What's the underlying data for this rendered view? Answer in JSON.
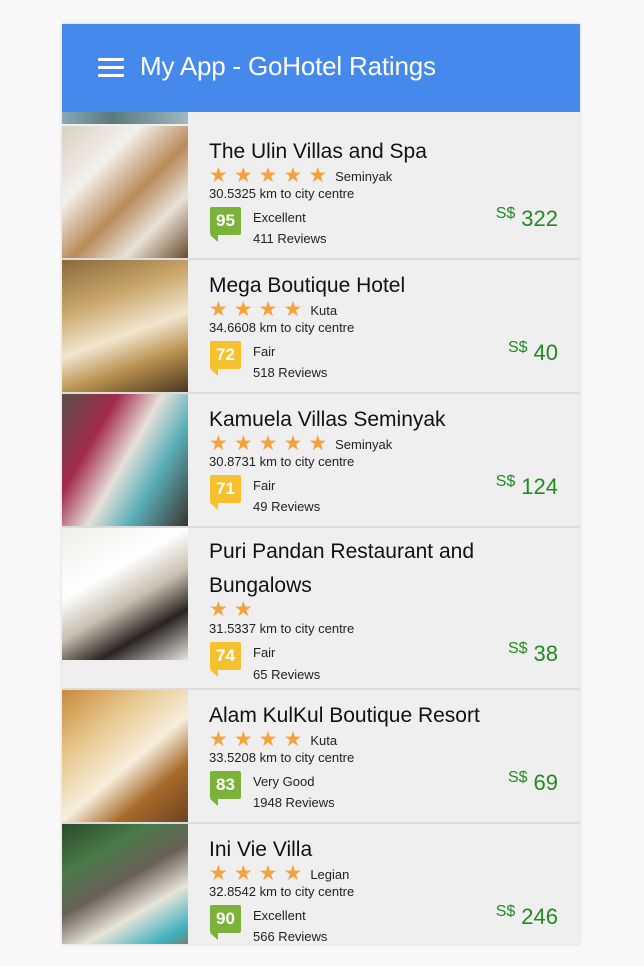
{
  "app": {
    "title": "My App - GoHotel Ratings"
  },
  "colors": {
    "header": "#4589ec",
    "star": "#f5a23a",
    "price": "#228a22",
    "score_good": "#7bb33a",
    "score_fair": "#f5c12e"
  },
  "hotels": [
    {
      "name": "The Ulin Villas and Spa",
      "stars": 5,
      "area": "Seminyak",
      "distance": "30.5325 km to city centre",
      "score": "95",
      "rating": "Excellent",
      "reviews": "411 Reviews",
      "currency": "S$",
      "price": "322",
      "score_color": "green"
    },
    {
      "name": "Mega Boutique Hotel",
      "stars": 4,
      "area": "Kuta",
      "distance": "34.6608 km to city centre",
      "score": "72",
      "rating": "Fair",
      "reviews": "518 Reviews",
      "currency": "S$",
      "price": "40",
      "score_color": "yellow"
    },
    {
      "name": "Kamuela Villas Seminyak",
      "stars": 5,
      "area": "Seminyak",
      "distance": "30.8731 km to city centre",
      "score": "71",
      "rating": "Fair",
      "reviews": "49 Reviews",
      "currency": "S$",
      "price": "124",
      "score_color": "yellow"
    },
    {
      "name": "Puri Pandan Restaurant and Bungalows",
      "stars": 2,
      "area": "",
      "distance": "31.5337 km to city centre",
      "score": "74",
      "rating": "Fair",
      "reviews": "65 Reviews",
      "currency": "S$",
      "price": "38",
      "score_color": "yellow"
    },
    {
      "name": "Alam KulKul Boutique Resort",
      "stars": 4,
      "area": "Kuta",
      "distance": "33.5208 km to city centre",
      "score": "83",
      "rating": "Very Good",
      "reviews": "1948 Reviews",
      "currency": "S$",
      "price": "69",
      "score_color": "green"
    },
    {
      "name": "Ini Vie Villa",
      "stars": 4,
      "area": "Legian",
      "distance": "32.8542 km to city centre",
      "score": "90",
      "rating": "Excellent",
      "reviews": "566 Reviews",
      "currency": "S$",
      "price": "246",
      "score_color": "green"
    }
  ]
}
